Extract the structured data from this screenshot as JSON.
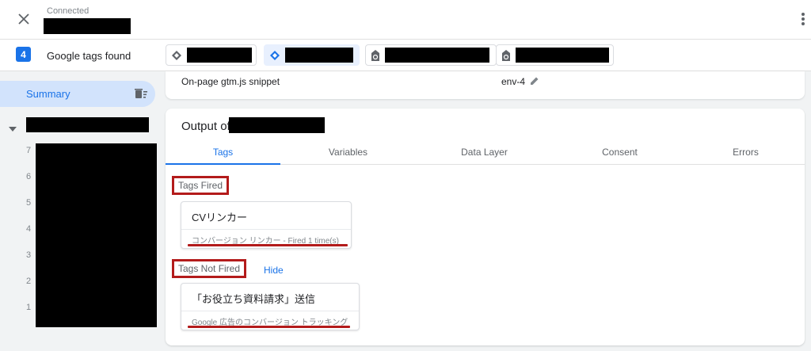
{
  "header": {
    "status_label": "Connected",
    "close_icon": "close-icon",
    "menu_icon": "more-vert-icon"
  },
  "tagbar": {
    "count": "4",
    "found_label": "Google tags found",
    "chips": [
      {
        "icon": "gtm-diamond-icon",
        "active": false
      },
      {
        "icon": "gtm-diamond-icon",
        "active": true
      },
      {
        "icon": "google-tag-icon",
        "active": false
      },
      {
        "icon": "google-tag-icon",
        "active": false
      }
    ]
  },
  "sidebar": {
    "summary_label": "Summary",
    "clear_icon": "delete-sweep-icon",
    "event_numbers": [
      "7",
      "6",
      "5",
      "4",
      "3",
      "2",
      "1"
    ]
  },
  "info": {
    "snippet_label": "On-page gtm.js snippet",
    "env_value": "env-4"
  },
  "output": {
    "title_prefix": "Output of",
    "tabs": [
      "Tags",
      "Variables",
      "Data Layer",
      "Consent",
      "Errors"
    ],
    "active_tab": "Tags",
    "fired_title": "Tags Fired",
    "fired_tags": [
      {
        "name": "CVリンカー",
        "meta": "コンバージョン リンカー - Fired 1 time(s)"
      }
    ],
    "not_fired_title": "Tags Not Fired",
    "hide_label": "Hide",
    "not_fired_tags": [
      {
        "name": "「お役立ち資料請求」送信",
        "meta": "Google 広告のコンバージョン トラッキング"
      }
    ]
  },
  "colors": {
    "accent": "#1a73e8",
    "highlight": "#b31b1b",
    "selected_bg": "#d2e3fc"
  }
}
